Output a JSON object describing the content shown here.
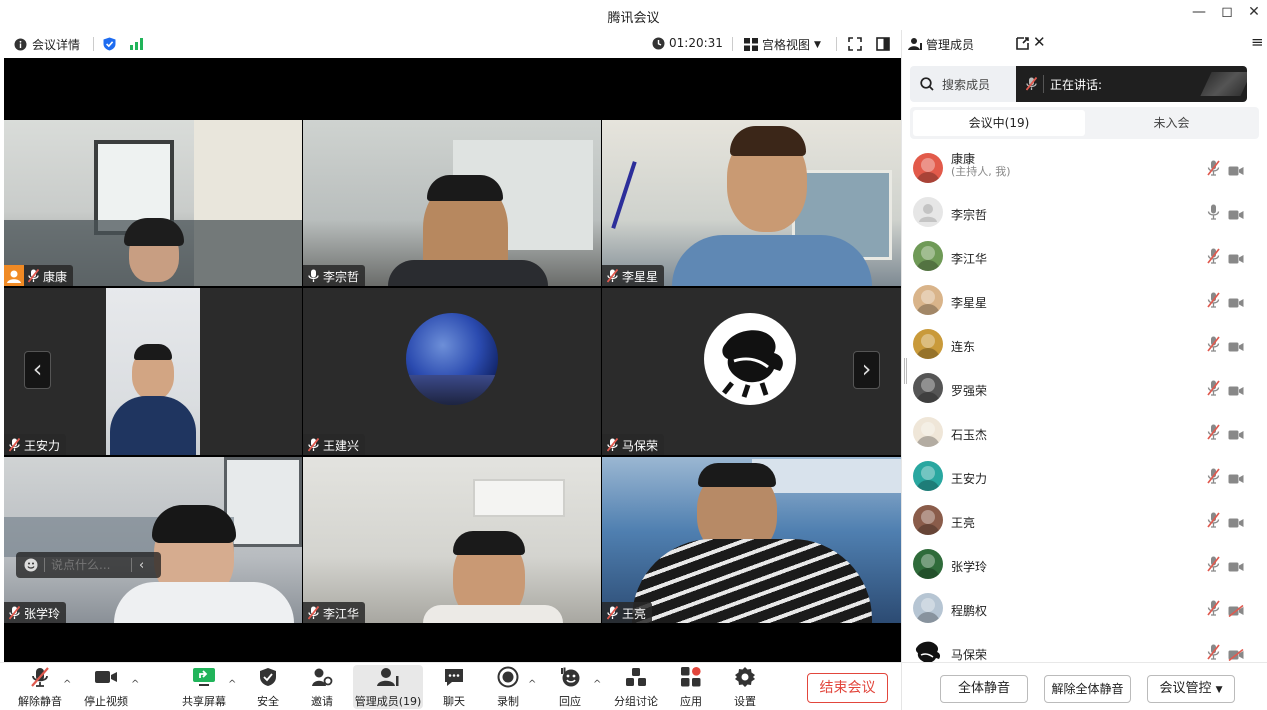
{
  "window": {
    "title": "腾讯会议",
    "controls": {
      "minimize": "—",
      "restore": "◻",
      "close": "✕"
    }
  },
  "infobar": {
    "details_label": "会议详情",
    "timer": "01:20:31",
    "view_label": "宫格视图"
  },
  "tiles": [
    {
      "name": "康康",
      "host": true,
      "mic": "muted",
      "kind": "video"
    },
    {
      "name": "李宗哲",
      "host": false,
      "mic": "on",
      "kind": "video"
    },
    {
      "name": "李星星",
      "host": false,
      "mic": "muted",
      "kind": "video"
    },
    {
      "name": "王安力",
      "host": false,
      "mic": "muted",
      "kind": "video"
    },
    {
      "name": "王建兴",
      "host": false,
      "mic": "muted",
      "kind": "avatar"
    },
    {
      "name": "马保荣",
      "host": false,
      "mic": "muted",
      "kind": "avatar"
    },
    {
      "name": "张学玲",
      "host": false,
      "mic": "muted",
      "kind": "video"
    },
    {
      "name": "李江华",
      "host": false,
      "mic": "muted",
      "kind": "video"
    },
    {
      "name": "王亮",
      "host": false,
      "mic": "muted",
      "kind": "video"
    }
  ],
  "nav": {
    "prev": "‹",
    "next": "›"
  },
  "chat_input": {
    "placeholder": "说点什么..."
  },
  "panel": {
    "title": "管理成员",
    "search_label": "搜索成员",
    "speaking_label": "正在讲话:",
    "tabs": [
      {
        "label": "会议中(19)",
        "active": true
      },
      {
        "label": "未入会",
        "active": false
      }
    ],
    "members": [
      {
        "name": "康康",
        "role": "(主持人, 我)",
        "mic": "muted",
        "video": "on",
        "avatar_color": "#e25a4a"
      },
      {
        "name": "李宗哲",
        "role": "",
        "mic": "on",
        "video": "on",
        "avatar_color": "#e6e6e6"
      },
      {
        "name": "李江华",
        "role": "",
        "mic": "muted",
        "video": "on",
        "avatar_color": "#6f9a57"
      },
      {
        "name": "李星星",
        "role": "",
        "mic": "muted",
        "video": "on",
        "avatar_color": "#d9b48a"
      },
      {
        "name": "连东",
        "role": "",
        "mic": "muted",
        "video": "on",
        "avatar_color": "#c99a3a"
      },
      {
        "name": "罗强荣",
        "role": "",
        "mic": "muted",
        "video": "on",
        "avatar_color": "#555555"
      },
      {
        "name": "石玉杰",
        "role": "",
        "mic": "muted",
        "video": "on",
        "avatar_color": "#efe6d8"
      },
      {
        "name": "王安力",
        "role": "",
        "mic": "muted",
        "video": "on",
        "avatar_color": "#29a7a0"
      },
      {
        "name": "王亮",
        "role": "",
        "mic": "muted",
        "video": "on",
        "avatar_color": "#8a5c4a"
      },
      {
        "name": "张学玲",
        "role": "",
        "mic": "muted",
        "video": "on",
        "avatar_color": "#2f6b3a"
      },
      {
        "name": "程鹏权",
        "role": "",
        "mic": "muted",
        "video": "off",
        "avatar_color": "#b6c5d3"
      },
      {
        "name": "马保荣",
        "role": "",
        "mic": "muted",
        "video": "off",
        "avatar_color": "#ffffff"
      }
    ]
  },
  "toolbar": {
    "unmute": "解除静音",
    "stop_video": "停止视频",
    "share_screen": "共享屏幕",
    "security": "安全",
    "invite": "邀请",
    "manage_members": "管理成员(19)",
    "chat": "聊天",
    "record": "录制",
    "reactions": "回应",
    "breakout": "分组讨论",
    "apps": "应用",
    "settings": "设置",
    "end_meeting": "结束会议"
  },
  "panel_footer": {
    "mute_all": "全体静音",
    "unmute_all": "解除全体静音",
    "meeting_control": "会议管控"
  },
  "colors": {
    "accent_blue": "#1e6cf0",
    "signal_green": "#21b45a",
    "end_red": "#e2463c",
    "muted_red": "#e05a4f",
    "host_orange": "#f08a24",
    "video_grey": "#555555"
  }
}
